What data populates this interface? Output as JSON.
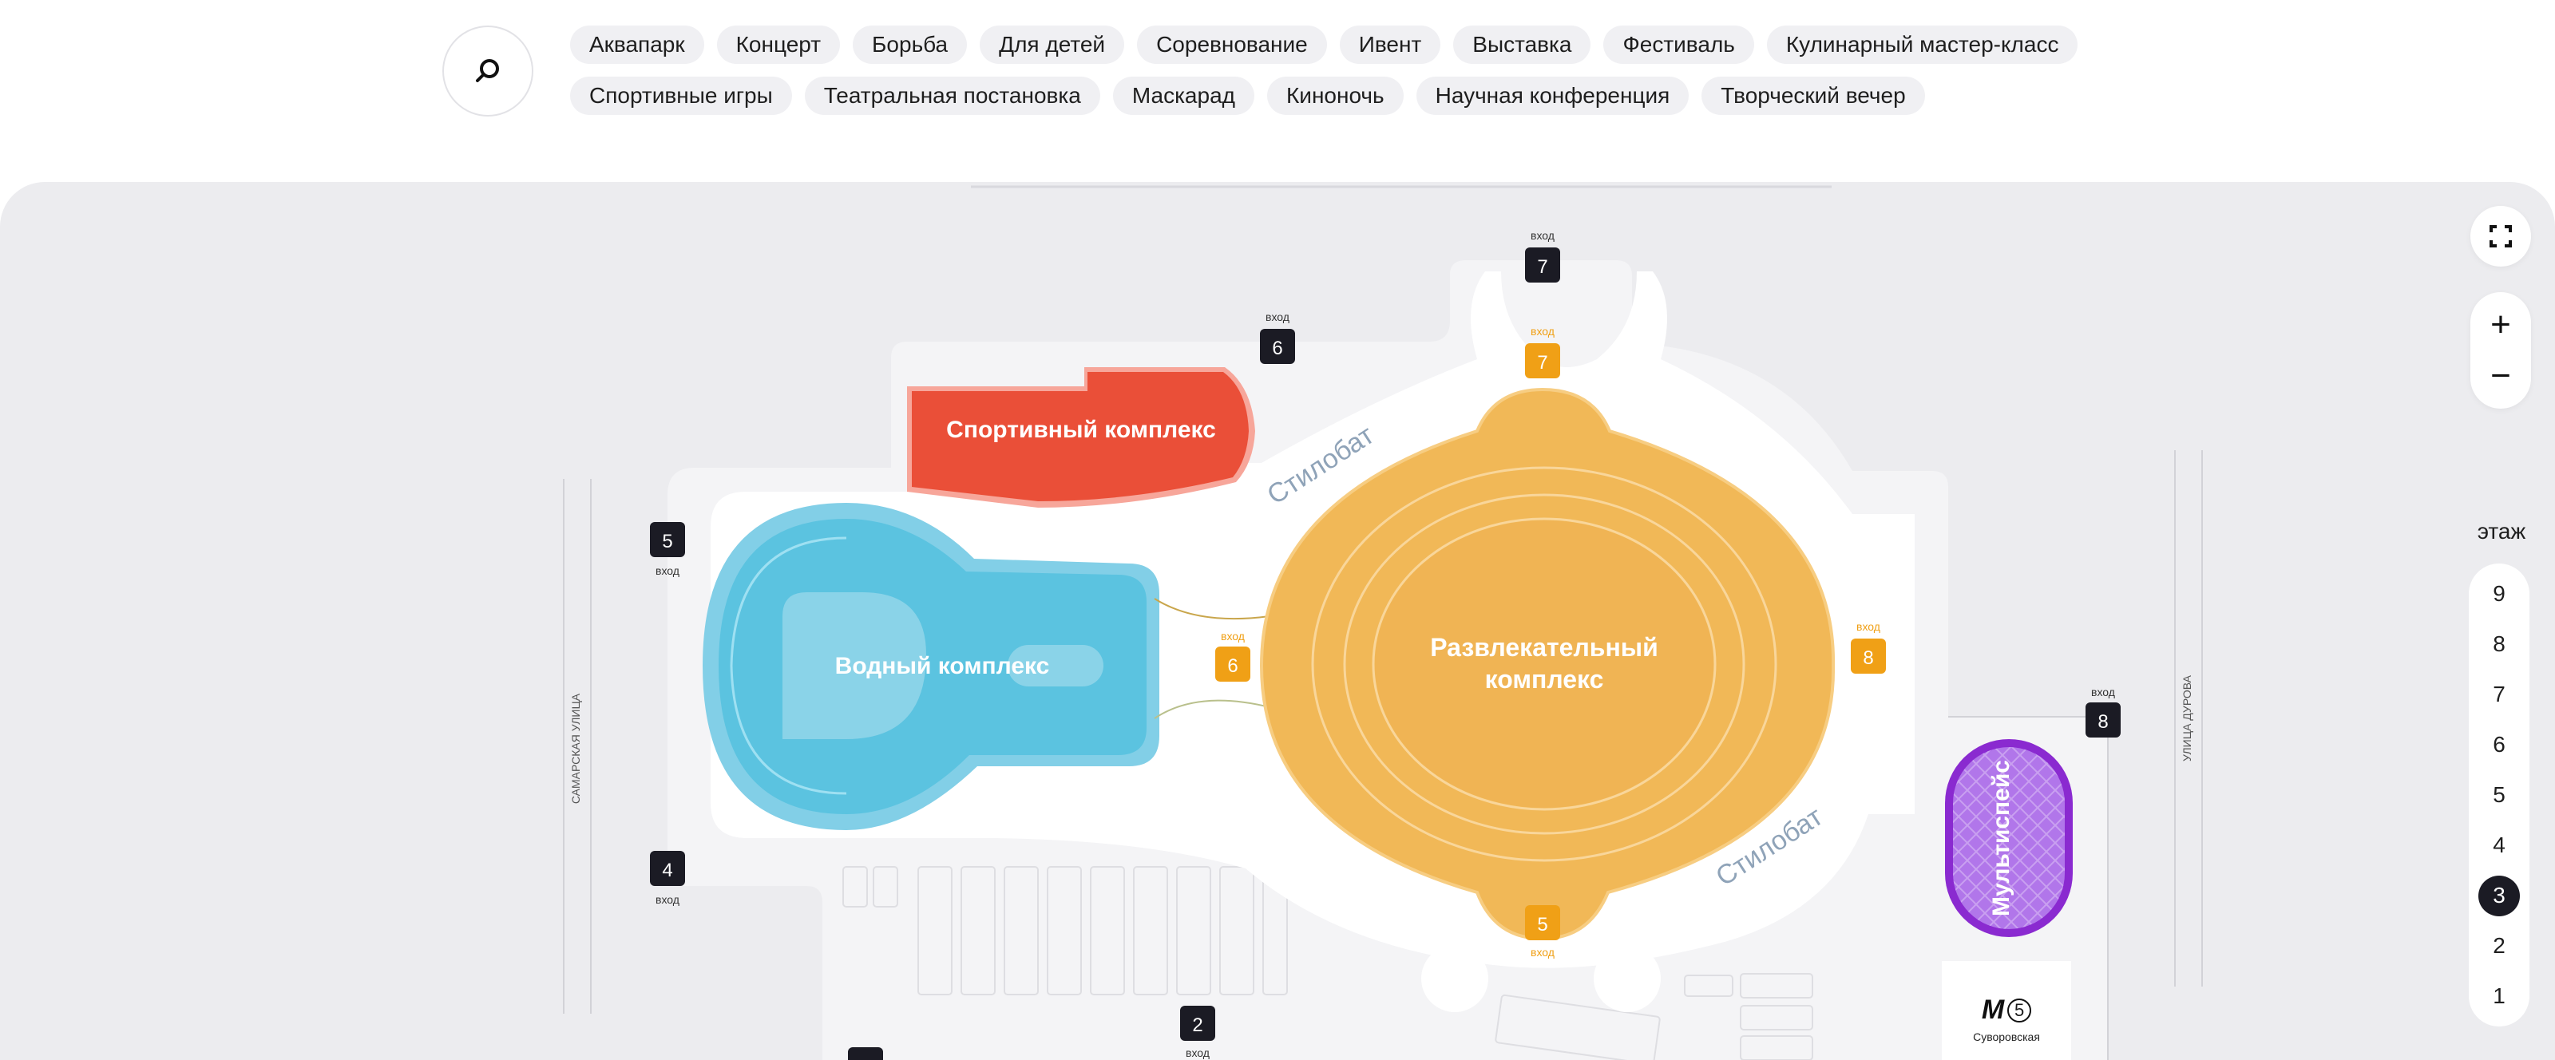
{
  "search": {
    "icon": "search-icon"
  },
  "filters": {
    "row1": [
      "Аквапарк",
      "Концерт",
      "Борьба",
      "Для детей",
      "Соревнование",
      "Ивент",
      "Выставка",
      "Фестиваль",
      "Кулинарный мастер-класс"
    ],
    "row2": [
      "Спортивные игры",
      "Театральная постановка",
      "Маскарад",
      "Киноночь",
      "Научная конференция",
      "Творческий вечер"
    ]
  },
  "map": {
    "venues": {
      "sport": "Спортивный комплекс",
      "water": "Водный комплекс",
      "entertainment_line1": "Развлекательный",
      "entertainment_line2": "комплекс",
      "multispace": "Мультиспейс"
    },
    "areas": {
      "stylobate_top": "Стилобат",
      "stylobate_bottom": "Стилобат"
    },
    "streets": {
      "left": "САМАРСКАЯ УЛИЦА",
      "right": "УЛИЦА ДУРОВА"
    },
    "entrance_word": "вход",
    "outer_entrances": [
      "7",
      "6",
      "5",
      "4",
      "2",
      "8"
    ],
    "inner_entrances": [
      "7",
      "6",
      "8",
      "5"
    ],
    "colors": {
      "sport": "#ea4f38",
      "water": "#5bc3e0",
      "entertainment": "#f1b857",
      "multispace": "#9b4ddb",
      "entrance_dark": "#1b1b24",
      "entrance_orange": "#f0a016"
    }
  },
  "metro": {
    "logo": "М",
    "line": "5",
    "station": "Суворовская"
  },
  "controls": {
    "fullscreen_icon": "fullscreen-icon",
    "zoom_in": "+",
    "zoom_out": "−",
    "floor_label": "этаж",
    "floors": [
      "9",
      "8",
      "7",
      "6",
      "5",
      "4",
      "3",
      "2",
      "1"
    ],
    "active_floor": "3"
  }
}
